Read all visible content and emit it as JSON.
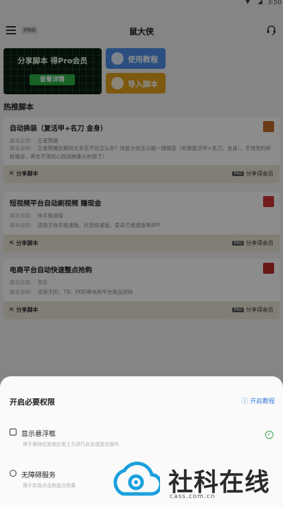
{
  "status": {
    "time": "3:50"
  },
  "header": {
    "pro_badge": "PRO",
    "title": "鼠大侠"
  },
  "banner": {
    "promo_title": "分享脚本 得Pro会员",
    "promo_button": "查看详情",
    "tutorial_label": "使用教程",
    "import_label": "导入脚本"
  },
  "section": {
    "hot_title": "热推脚本"
  },
  "scripts": [
    {
      "name": "自动换装（复活甲+名刀 金身）",
      "app_label": "脚本应用:",
      "app_value": "王者荣耀",
      "desc_label": "脚本说明:",
      "desc_value": "王者荣耀后期线太多花不完怎么办？用鼠大侠连点器一键换装（秒换复活甲+名刀、金身），手残党的终极福音，再也不用担心团战被集火秒掉了！",
      "share_label": "分享脚本",
      "pro_tag": "PRO",
      "reward_label": "分享得会员",
      "thumb_color": "#c46a2a"
    },
    {
      "name": "短视频平台自动刷视频 赚现金",
      "app_label": "脚本应用:",
      "app_value": "快手极速版",
      "desc_label": "脚本说明:",
      "desc_value": "适用于快手极速版、抖音极速版、爱奇艺极速版等APP",
      "share_label": "分享脚本",
      "pro_tag": "PRO",
      "reward_label": "分享得会员",
      "thumb_color": "#d2353a"
    },
    {
      "name": "电商平台自动快速整点抢购",
      "app_label": "脚本应用:",
      "app_value": "京东",
      "desc_label": "脚本说明:",
      "desc_value": "适用于JD、TB、PDD等电商平台商品抢购",
      "share_label": "分享脚本",
      "pro_tag": "PRO",
      "reward_label": "分享得会员",
      "thumb_color": "#c22a2a"
    }
  ],
  "sheet": {
    "title": "开启必要权限",
    "help_label": "开启教程",
    "permissions": [
      {
        "name": "显示悬浮框",
        "desc": "用于保持在其他应用上方进行点击或连点操作",
        "granted": true
      },
      {
        "name": "无障碍服务",
        "desc": "用于实现点击和连点效果",
        "granted": false
      }
    ]
  },
  "watermark": {
    "text": "社科在线",
    "url": "cass.com.cn"
  }
}
